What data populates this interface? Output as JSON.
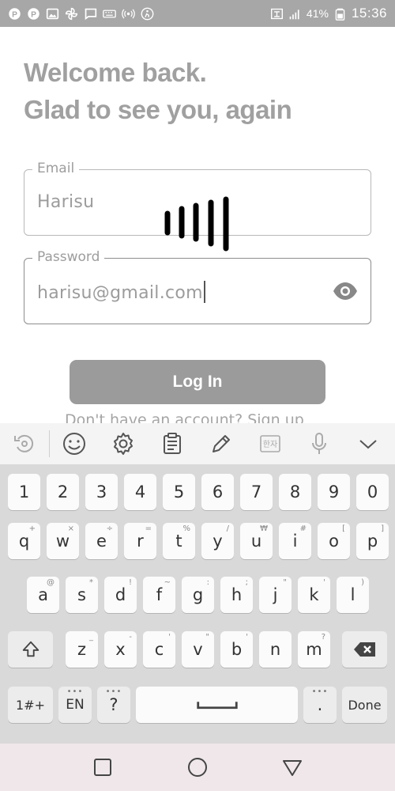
{
  "statusbar": {
    "battery": "41%",
    "time": "15:36"
  },
  "heading": {
    "line1": "Welcome back.",
    "line2": "Glad to see you, again"
  },
  "email": {
    "label": "Email",
    "value": "Harisu"
  },
  "password": {
    "label": "Password",
    "value": "harisu@gmail.com"
  },
  "login_label": "Log In",
  "signup_text": "Don't have an account? Sign up",
  "keyboard": {
    "toolbar": [
      {
        "name": "rotate-icon"
      },
      {
        "name": "emoji-icon"
      },
      {
        "name": "settings-icon"
      },
      {
        "name": "clipboard-icon"
      },
      {
        "name": "pencil-icon"
      },
      {
        "name": "hanja-icon",
        "label": "한자"
      },
      {
        "name": "mic-icon"
      },
      {
        "name": "chevron-down-icon"
      }
    ],
    "row_numbers": [
      "1",
      "2",
      "3",
      "4",
      "5",
      "6",
      "7",
      "8",
      "9",
      "0"
    ],
    "row1": [
      {
        "key": "q",
        "hint": "+"
      },
      {
        "key": "w",
        "hint": "×"
      },
      {
        "key": "e",
        "hint": "÷"
      },
      {
        "key": "r",
        "hint": "="
      },
      {
        "key": "t",
        "hint": "%"
      },
      {
        "key": "y",
        "hint": "/"
      },
      {
        "key": "u",
        "hint": "₩"
      },
      {
        "key": "i",
        "hint": "#"
      },
      {
        "key": "o",
        "hint": "["
      },
      {
        "key": "p",
        "hint": "]"
      }
    ],
    "row2": [
      {
        "key": "a",
        "hint": "@"
      },
      {
        "key": "s",
        "hint": "*"
      },
      {
        "key": "d",
        "hint": "!"
      },
      {
        "key": "f",
        "hint": "~"
      },
      {
        "key": "g",
        "hint": ":"
      },
      {
        "key": "h",
        "hint": ";"
      },
      {
        "key": "j",
        "hint": "\""
      },
      {
        "key": "k",
        "hint": "'"
      },
      {
        "key": "l",
        "hint": ")"
      }
    ],
    "row3": [
      {
        "key": "z",
        "hint": "_"
      },
      {
        "key": "x",
        "hint": "-"
      },
      {
        "key": "c",
        "hint": "'"
      },
      {
        "key": "v",
        "hint": "\""
      },
      {
        "key": "b",
        "hint": "'"
      },
      {
        "key": "n",
        "hint": ""
      },
      {
        "key": "m",
        "hint": "?"
      }
    ],
    "symbols_key": "1#+",
    "language_key": "EN",
    "question_key": "?",
    "period_key": ".",
    "done_key": "Done"
  }
}
